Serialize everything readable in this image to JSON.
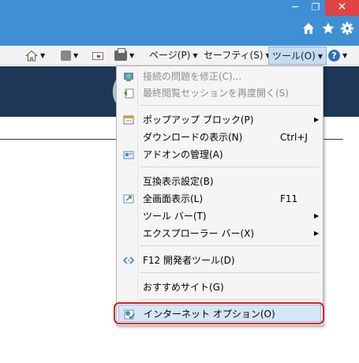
{
  "window": {
    "minimize_glyph": "─",
    "maximize_glyph": "❐",
    "close_glyph": "✕",
    "icons": [
      "home-icon",
      "star-icon",
      "gear-icon"
    ]
  },
  "command_bar": {
    "page_label": "ページ(P)",
    "safety_label": "セーフティ(S)",
    "tools_label": "ツール(O)",
    "help_glyph": "?"
  },
  "tools_menu": {
    "items": [
      {
        "label": "接続の問題を修正(C)...",
        "enabled": false,
        "icon": "network-diagnose-icon"
      },
      {
        "label": "最終閲覧セッションを再度開く(S)",
        "enabled": false,
        "icon": "reopen-session-icon"
      },
      {
        "label": "ポップアップ ブロック(P)",
        "enabled": true,
        "icon": "popup-blocker-icon",
        "submenu": true
      },
      {
        "label": "ダウンロードの表示(N)",
        "enabled": true,
        "shortcut": "Ctrl+J"
      },
      {
        "label": "アドオンの管理(A)",
        "enabled": true,
        "icon": "addons-icon"
      },
      {
        "label": "互換表示設定(B)",
        "enabled": true
      },
      {
        "label": "全画面表示(L)",
        "enabled": true,
        "icon": "fullscreen-icon",
        "shortcut": "F11"
      },
      {
        "label": "ツール バー(T)",
        "enabled": true,
        "submenu": true
      },
      {
        "label": "エクスプローラー バー(X)",
        "enabled": true,
        "submenu": true
      },
      {
        "label": "F12 開発者ツール(D)",
        "enabled": true,
        "icon": "dev-tools-icon"
      },
      {
        "label": "おすすめサイト(G)",
        "enabled": true
      },
      {
        "label": "インターネット オプション(O)",
        "enabled": true,
        "icon": "internet-options-icon",
        "highlighted": true
      }
    ]
  },
  "colors": {
    "title_bar": "#3f8fd5",
    "close_button": "#e04343",
    "banner": "#1e3755",
    "highlight": "#d5e6f7",
    "callout_ring": "#e01c1c"
  }
}
